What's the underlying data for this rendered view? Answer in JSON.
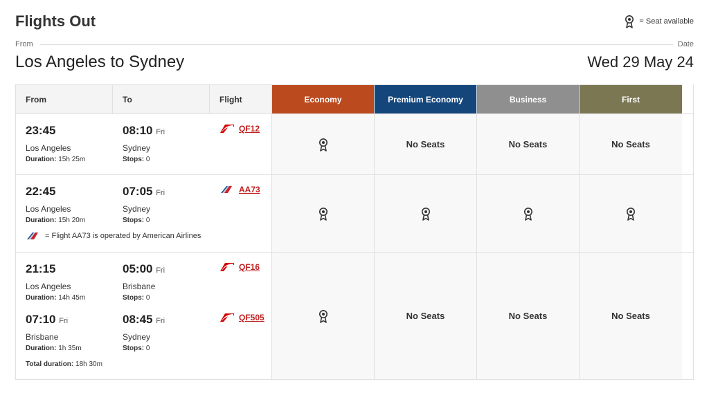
{
  "header": {
    "title": "Flights Out",
    "legend_text": "= Seat available",
    "from_label": "From",
    "date_label": "Date",
    "route": "Los Angeles to Sydney",
    "date": "Wed 29 May 24"
  },
  "columns": {
    "from": "From",
    "to": "To",
    "flight": "Flight",
    "economy": "Economy",
    "premium": "Premium Economy",
    "business": "Business",
    "first": "First"
  },
  "labels": {
    "duration_prefix": "Duration:",
    "stops_prefix": "Stops:",
    "total_duration_prefix": "Total duration:",
    "no_seats": "No Seats"
  },
  "flights": [
    {
      "segments": [
        {
          "dep_time": "23:45",
          "dep_day": "",
          "arr_time": "08:10",
          "arr_day": "Fri",
          "dep_city": "Los Angeles",
          "arr_city": "Sydney",
          "duration": "15h 25m",
          "stops": "0",
          "carrier": "qantas",
          "flight_no": "QF12"
        }
      ],
      "availability": {
        "economy": "seat",
        "premium": "none",
        "business": "none",
        "first": "none"
      }
    },
    {
      "segments": [
        {
          "dep_time": "22:45",
          "dep_day": "",
          "arr_time": "07:05",
          "arr_day": "Fri",
          "dep_city": "Los Angeles",
          "arr_city": "Sydney",
          "duration": "15h 20m",
          "stops": "0",
          "carrier": "aa",
          "flight_no": "AA73"
        }
      ],
      "operated_note": "= Flight AA73 is operated by American Airlines",
      "availability": {
        "economy": "seat",
        "premium": "seat",
        "business": "seat",
        "first": "seat"
      }
    },
    {
      "segments": [
        {
          "dep_time": "21:15",
          "dep_day": "",
          "arr_time": "05:00",
          "arr_day": "Fri",
          "dep_city": "Los Angeles",
          "arr_city": "Brisbane",
          "duration": "14h 45m",
          "stops": "0",
          "carrier": "qantas",
          "flight_no": "QF16"
        },
        {
          "dep_time": "07:10",
          "dep_day": "Fri",
          "arr_time": "08:45",
          "arr_day": "Fri",
          "dep_city": "Brisbane",
          "arr_city": "Sydney",
          "duration": "1h 35m",
          "stops": "0",
          "carrier": "qantas",
          "flight_no": "QF505"
        }
      ],
      "total_duration": "18h 30m",
      "availability": {
        "economy": "seat",
        "premium": "none",
        "business": "none",
        "first": "none"
      }
    }
  ]
}
